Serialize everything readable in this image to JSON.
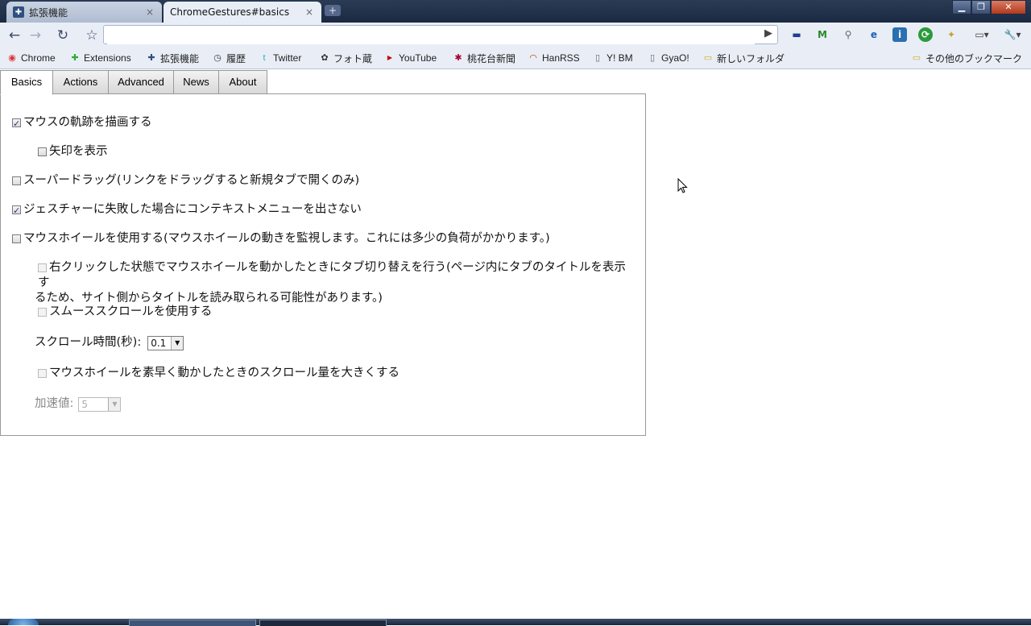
{
  "tabs": [
    {
      "title": "拡張機能",
      "active": false
    },
    {
      "title": "ChromeGestures#basics",
      "active": true
    }
  ],
  "toolbar": {
    "omnibox_value": ""
  },
  "bookmarks": [
    {
      "label": "Chrome",
      "icon": "chrome-icon"
    },
    {
      "label": "Extensions",
      "icon": "puzzle-icon"
    },
    {
      "label": "拡張機能",
      "icon": "puzzle-icon"
    },
    {
      "label": "履歴",
      "icon": "clock-icon"
    },
    {
      "label": "Twitter",
      "icon": "twitter-icon"
    },
    {
      "label": "フォト蔵",
      "icon": "camera-icon"
    },
    {
      "label": "YouTube",
      "icon": "youtube-icon"
    },
    {
      "label": "桃花台新聞",
      "icon": "flower-icon"
    },
    {
      "label": "HanRSS",
      "icon": "rss-icon"
    },
    {
      "label": "Y! BM",
      "icon": "page-icon"
    },
    {
      "label": "GyaO!",
      "icon": "page-icon"
    },
    {
      "label": "新しいフォルダ",
      "icon": "folder-icon"
    }
  ],
  "other_bookmarks": "その他のブックマーク",
  "page_tabs": [
    "Basics",
    "Actions",
    "Advanced",
    "News",
    "About"
  ],
  "options": {
    "draw_trail": "マウスの軌跡を描画する",
    "show_arrow": "矢印を表示",
    "super_drag": "スーパードラッグ(リンクをドラッグすると新規タブで開くのみ)",
    "no_context_menu": "ジェスチャーに失敗した場合にコンテキストメニューを出さない",
    "use_wheel": "マウスホイールを使用する(マウスホイールの動きを監視します。これには多少の負荷がかかります。)",
    "wheel_tab_switch_line1": "右クリックした状態でマウスホイールを動かしたときにタブ切り替えを行う(ページ内にタブのタイトルを表示す",
    "wheel_tab_switch_line2": "るため、サイト側からタイトルを読み取られる可能性があります。)",
    "smooth_scroll": "スムーススクロールを使用する",
    "scroll_time_label": "スクロール時間(秒):",
    "scroll_time_value": "0.1",
    "accel_scroll": "マウスホイールを素早く動かしたときのスクロール量を大きくする",
    "accel_label": "加速値:",
    "accel_value": "5"
  },
  "colors": {
    "accent": "#2b3b55",
    "toolbar": "#e9eef6"
  }
}
